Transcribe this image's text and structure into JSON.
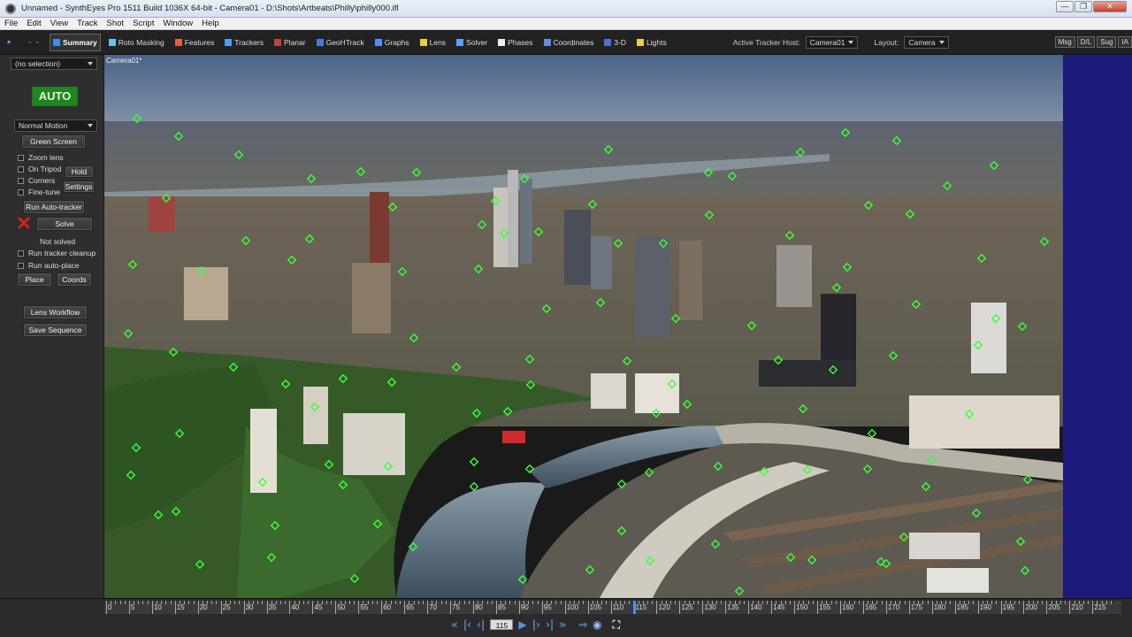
{
  "window": {
    "title": "Unnamed - SynthEyes Pro 1511 Build 1036X 64-bit - Camera01 - D:\\Shots\\Artbeats\\Philly\\philly000.ifl",
    "buttons": [
      "—",
      "❐",
      "✕"
    ]
  },
  "menu": [
    "File",
    "Edit",
    "View",
    "Track",
    "Shot",
    "Script",
    "Window",
    "Help"
  ],
  "toolbar": {
    "rooms": [
      {
        "label": "Summary",
        "color": "#3a8fe8",
        "active": true
      },
      {
        "label": "Roto Masking",
        "color": "#6cc0f0",
        "active": false
      },
      {
        "label": "Features",
        "color": "#e06040",
        "active": false
      },
      {
        "label": "Trackers",
        "color": "#4aa0ff",
        "active": false
      },
      {
        "label": "Planar",
        "color": "#c04040",
        "active": false
      },
      {
        "label": "GeoHTrack",
        "color": "#4a7ae0",
        "active": false
      },
      {
        "label": "Graphs",
        "color": "#4a90ff",
        "active": false
      },
      {
        "label": "Lens",
        "color": "#e8d040",
        "active": false
      },
      {
        "label": "Solver",
        "color": "#5aa0ff",
        "active": false
      },
      {
        "label": "Phases",
        "color": "#eeeeee",
        "active": false
      },
      {
        "label": "Coordinates",
        "color": "#6a8adf",
        "active": false
      },
      {
        "label": "3-D",
        "color": "#4a70d0",
        "active": false
      },
      {
        "label": "Lights",
        "color": "#f0d040",
        "active": false
      }
    ],
    "active_tracker_host_label": "Active Tracker Host:",
    "active_tracker_host_value": "Camera01",
    "layout_label": "Layout:",
    "layout_value": "Camera",
    "right_buttons": [
      "Msg",
      "D/L",
      "Sug",
      "IA"
    ]
  },
  "left_panel": {
    "selection": "(no selection)",
    "auto_label": "AUTO",
    "motion": "Normal Motion",
    "green_screen": "Green Screen",
    "zoom_lens": "Zoom lens",
    "on_tripod": "On Tripod",
    "hold": "Hold",
    "corners": "Corners",
    "fine_tune": "Fine-tune",
    "settings": "Settings",
    "run_auto_tracker": "Run Auto-tracker",
    "solve": "Solve",
    "status": "Not solved",
    "run_tracker_cleanup": "Run tracker cleanup",
    "run_auto_place": "Run auto-place",
    "place": "Place",
    "coords": "Coords",
    "lens_workflow": "Lens Workflow",
    "save_sequence": "Save Sequence",
    "colors": {
      "auto_bg": "#1a8a1a",
      "error_x": "#d82020"
    }
  },
  "viewport": {
    "camera_label": "Camera01*",
    "blue_band_color": "#1c1a7a",
    "tracker_color": "#39ff39"
  },
  "timeline": {
    "ticks": [
      0,
      5,
      10,
      15,
      20,
      25,
      30,
      35,
      40,
      45,
      50,
      55,
      60,
      65,
      70,
      75,
      80,
      85,
      90,
      95,
      100,
      105,
      110,
      115,
      120,
      125,
      130,
      135,
      140,
      145,
      150,
      155,
      160,
      165,
      170,
      175,
      180,
      185,
      190,
      195,
      200,
      205,
      210,
      215
    ],
    "max_frame": 219,
    "current_frame": "115",
    "current_frame_value": 115
  }
}
